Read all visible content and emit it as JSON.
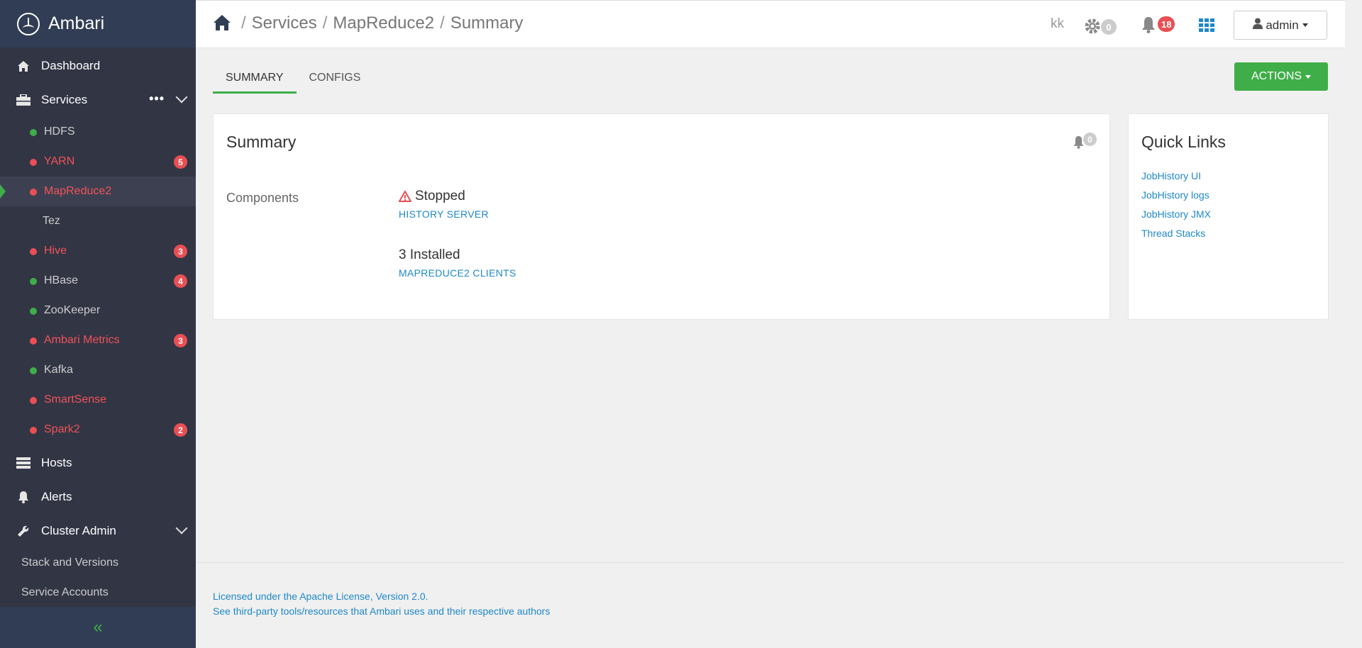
{
  "brand": {
    "name": "Ambari"
  },
  "nav": {
    "dashboard": "Dashboard",
    "services": "Services",
    "services_more": "•••",
    "hosts": "Hosts",
    "alerts": "Alerts",
    "cluster_admin": "Cluster Admin"
  },
  "services": [
    {
      "label": "HDFS",
      "status": "green",
      "badge": null
    },
    {
      "label": "YARN",
      "status": "red",
      "badge": "5"
    },
    {
      "label": "MapReduce2",
      "status": "red",
      "badge": null
    },
    {
      "label": "Tez",
      "status": "none",
      "badge": null
    },
    {
      "label": "Hive",
      "status": "red",
      "badge": "3"
    },
    {
      "label": "HBase",
      "status": "green",
      "badge": "4"
    },
    {
      "label": "ZooKeeper",
      "status": "green",
      "badge": null
    },
    {
      "label": "Ambari Metrics",
      "status": "red",
      "badge": "3"
    },
    {
      "label": "Kafka",
      "status": "green",
      "badge": null
    },
    {
      "label": "SmartSense",
      "status": "red",
      "badge": null
    },
    {
      "label": "Spark2",
      "status": "red",
      "badge": "2"
    }
  ],
  "cluster_admin_items": [
    "Stack and Versions",
    "Service Accounts"
  ],
  "collapse_label": "«",
  "breadcrumb": {
    "items": [
      "Services",
      "MapReduce2",
      "Summary"
    ],
    "separator": "/"
  },
  "topbar": {
    "initials": "kk",
    "ops_count": "0",
    "alerts_count": "18",
    "user": "admin"
  },
  "tabs": {
    "summary": "SUMMARY",
    "configs": "CONFIGS"
  },
  "actions_label": "ACTIONS",
  "summary": {
    "title": "Summary",
    "alert_count": "0",
    "components_label": "Components",
    "stopped_status": "Stopped",
    "stopped_link": "HISTORY SERVER",
    "installed_status": "3 Installed",
    "installed_link": "MAPREDUCE2 CLIENTS"
  },
  "quick_links": {
    "title": "Quick Links",
    "items": [
      "JobHistory UI",
      "JobHistory logs",
      "JobHistory JMX",
      "Thread Stacks"
    ]
  },
  "footer": {
    "license": "Licensed under the Apache License, Version 2.0.",
    "third_party": "See third-party tools/resources that Ambari uses and their respective authors"
  },
  "colors": {
    "green": "#3fae49",
    "red": "#e94f53",
    "link": "#1e88c7",
    "sidebar": "#323544"
  }
}
